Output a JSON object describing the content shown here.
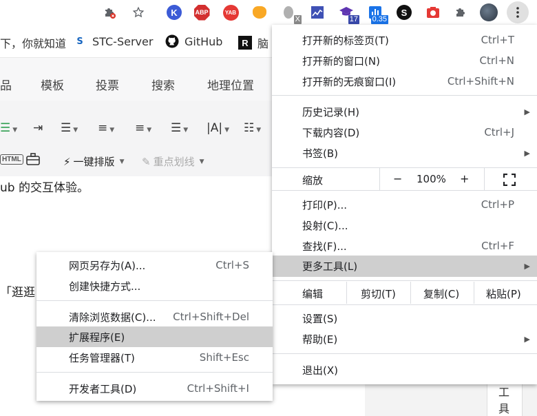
{
  "toolbar": {
    "extensions": [
      {
        "name": "puzzle-x-icon"
      },
      {
        "name": "star-icon"
      },
      {
        "name": "kami-icon",
        "glyph": "K",
        "color": "#3c5bd6"
      },
      {
        "name": "adblock-plus-icon",
        "glyph": "ABP",
        "color": "#d32f2f"
      },
      {
        "name": "yab-icon",
        "glyph": "YAB",
        "color": "#e53935"
      },
      {
        "name": "tampermonkey-icon",
        "glyph": "🐵",
        "color": "#f9a825"
      },
      {
        "name": "leaf-x-icon",
        "badge": "X"
      },
      {
        "name": "chart-icon"
      },
      {
        "name": "graduation-cap-icon",
        "badge": "17"
      },
      {
        "name": "bar-chart-icon",
        "badge": "0.35"
      },
      {
        "name": "s-logo-icon",
        "glyph": "S"
      },
      {
        "name": "camera-icon"
      },
      {
        "name": "puzzle-icon"
      },
      {
        "name": "avatar"
      },
      {
        "name": "kebab-menu-icon"
      }
    ]
  },
  "bookmarks": {
    "item1": "下，你就知道",
    "item2": "STC-Server",
    "item3": "GitHub",
    "item4": "脑"
  },
  "page": {
    "tabs": [
      "品",
      "模板",
      "投票",
      "搜索",
      "地理位置"
    ],
    "format_buttons": {
      "one_click": "一键排版",
      "highlight": "重点划线"
    },
    "line1": "ub 的交互体验。",
    "line2": "「逛逛"
  },
  "main_menu": {
    "items": [
      {
        "label": "打开新的标签页(T)",
        "shortcut": "Ctrl+T"
      },
      {
        "label": "打开新的窗口(N)",
        "shortcut": "Ctrl+N"
      },
      {
        "label": "打开新的无痕窗口(I)",
        "shortcut": "Ctrl+Shift+N"
      },
      {
        "label": "历史记录(H)",
        "shortcut": ""
      },
      {
        "label": "下载内容(D)",
        "shortcut": "Ctrl+J"
      },
      {
        "label": "书签(B)",
        "shortcut": ""
      },
      {
        "label": "打印(P)...",
        "shortcut": "Ctrl+P"
      },
      {
        "label": "投射(C)...",
        "shortcut": ""
      },
      {
        "label": "查找(F)...",
        "shortcut": "Ctrl+F"
      },
      {
        "label": "更多工具(L)",
        "shortcut": ""
      },
      {
        "label": "设置(S)",
        "shortcut": ""
      },
      {
        "label": "帮助(E)",
        "shortcut": ""
      },
      {
        "label": "退出(X)",
        "shortcut": ""
      }
    ],
    "zoom": {
      "label": "缩放",
      "minus": "−",
      "value": "100%",
      "plus": "+"
    },
    "edit": {
      "label": "编辑",
      "cut": "剪切(T)",
      "copy": "复制(C)",
      "paste": "粘贴(P)"
    }
  },
  "sub_menu": {
    "items": [
      {
        "label": "网页另存为(A)...",
        "shortcut": "Ctrl+S"
      },
      {
        "label": "创建快捷方式...",
        "shortcut": ""
      },
      {
        "label": "清除浏览数据(C)...",
        "shortcut": "Ctrl+Shift+Del"
      },
      {
        "label": "扩展程序(E)",
        "shortcut": ""
      },
      {
        "label": "任务管理器(T)",
        "shortcut": "Shift+Esc"
      },
      {
        "label": "开发者工具(D)",
        "shortcut": "Ctrl+Shift+I"
      }
    ]
  },
  "side_tool": {
    "char1": "工",
    "char2": "具"
  }
}
